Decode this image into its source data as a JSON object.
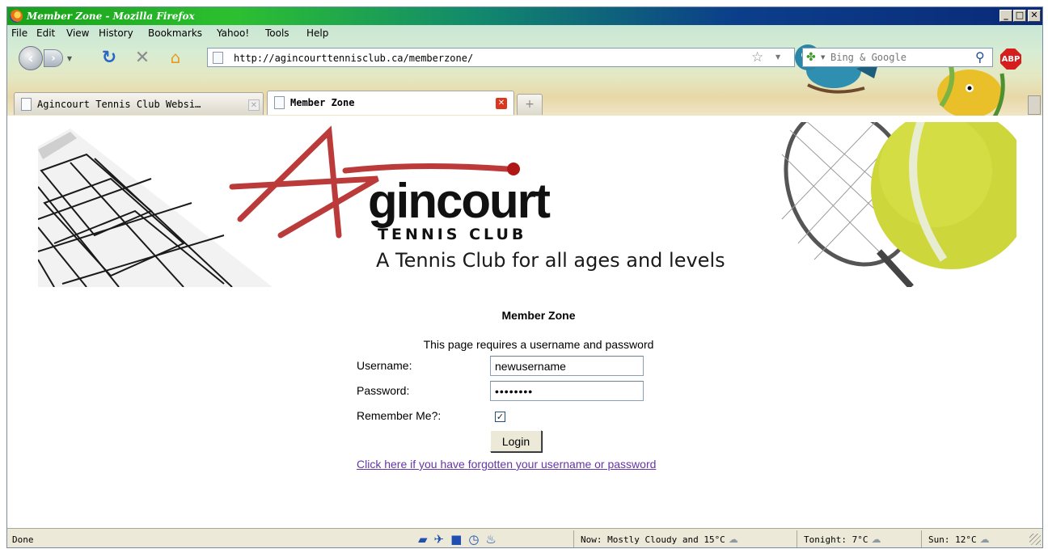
{
  "window": {
    "title": "Member Zone - Mozilla Firefox",
    "minimize_glyph": "_",
    "maximize_glyph": "□",
    "close_glyph": "✕"
  },
  "menu": [
    "File",
    "Edit",
    "View",
    "History",
    "Bookmarks",
    "Yahoo!",
    "Tools",
    "Help"
  ],
  "nav": {
    "url": "http://agincourttennisclub.ca/memberzone/",
    "search_placeholder": "Bing & Google",
    "adblock_label": "ABP"
  },
  "tabs": [
    {
      "label": "Agincourt Tennis Club Websi…",
      "active": false
    },
    {
      "label": "Member Zone",
      "active": true
    }
  ],
  "banner": {
    "logo_word": "gincourt",
    "logo_sub": "TENNIS CLUB",
    "tagline": "A Tennis Club for all ages and levels"
  },
  "page": {
    "heading": "Member Zone",
    "note": "This page requires a username and password",
    "username_label": "Username:",
    "username_value": "newusername",
    "password_label": "Password:",
    "password_value": "••••••••",
    "remember_label": "Remember Me?:",
    "remember_checked": true,
    "login_label": "Login",
    "forgot_link": "Click here if you have forgotten your username or password"
  },
  "statusbar": {
    "status": "Done",
    "weather_now": "Now: Mostly Cloudy and 15°C",
    "weather_tonight": "Tonight: 7°C",
    "weather_sun": "Sun: 12°C"
  },
  "colors": {
    "link_visited": "#6636a8",
    "logo_red": "#b01818",
    "titlebar_start": "#18a018",
    "titlebar_end": "#0a2a78"
  }
}
